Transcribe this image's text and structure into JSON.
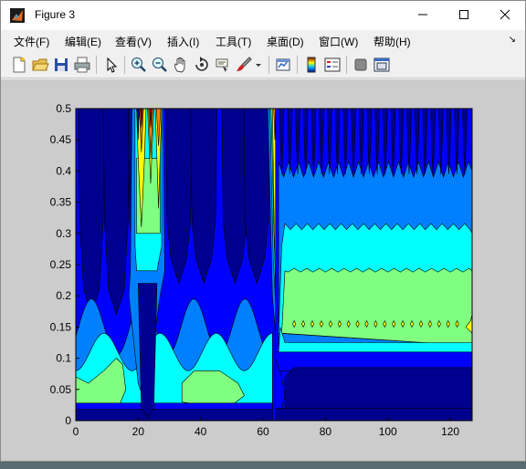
{
  "window": {
    "title": "Figure 3"
  },
  "menu": [
    {
      "label": "文件(F)"
    },
    {
      "label": "编辑(E)"
    },
    {
      "label": "查看(V)"
    },
    {
      "label": "插入(I)"
    },
    {
      "label": "工具(T)"
    },
    {
      "label": "桌面(D)"
    },
    {
      "label": "窗口(W)"
    },
    {
      "label": "帮助(H)"
    }
  ],
  "toolbar": {
    "icons": [
      "new-figure-icon",
      "open-file-icon",
      "save-icon",
      "print-icon",
      "select-arrow-icon",
      "zoom-in-icon",
      "zoom-out-icon",
      "pan-hand-icon",
      "rotate-3d-icon",
      "data-cursor-icon",
      "brush-icon",
      "brush-dropdown-icon",
      "link-plot-icon",
      "colorbar-icon",
      "legend-icon",
      "hide-plot-tools-icon",
      "show-plot-tools-icon"
    ]
  },
  "chart_data": {
    "type": "heatmap",
    "subtype": "filled-contour",
    "title": "",
    "xlabel": "",
    "ylabel": "",
    "xlim": [
      0,
      127
    ],
    "ylim": [
      0,
      0.5
    ],
    "x_ticks": [
      "0",
      "20",
      "40",
      "60",
      "80",
      "100",
      "120"
    ],
    "y_ticks": [
      "0",
      "0.05",
      "0.1",
      "0.15",
      "0.2",
      "0.25",
      "0.3",
      "0.35",
      "0.4",
      "0.45",
      "0.5"
    ],
    "colormap": "jet",
    "colors": {
      "lowest": "#00008f",
      "low": "#0000ff",
      "mid_low": "#0080ff",
      "mid": "#00ffff",
      "mid_high": "#80ff80",
      "high": "#ffff00",
      "very_high": "#ff8000",
      "highest": "#800000"
    },
    "bands": [
      {
        "region": "x 0-65",
        "y": [
          0,
          0.02
        ],
        "level": "lowest"
      },
      {
        "region": "x 65-127",
        "y": [
          0.02,
          0.08
        ],
        "level": "lowest"
      },
      {
        "region": "x 65-127",
        "y": [
          0.08,
          0.12
        ],
        "level": "low"
      },
      {
        "region": "x 65-127",
        "y": [
          0.12,
          0.24
        ],
        "level": "mid_high"
      },
      {
        "region": "x 65-127",
        "y": [
          0.24,
          0.31
        ],
        "level": "mid"
      },
      {
        "region": "x 65-127",
        "y": [
          0.31,
          0.4
        ],
        "level": "mid_low"
      },
      {
        "region": "x 65-127",
        "y": [
          0.4,
          0.5
        ],
        "level": "low"
      }
    ],
    "peaks": [
      {
        "x": 22,
        "y": [
          0.3,
          0.5
        ],
        "level": "highest"
      },
      {
        "x": 64,
        "y": [
          0.2,
          0.5
        ],
        "level": "high"
      },
      {
        "x": 126,
        "y": [
          0.15,
          0.15
        ],
        "level": "high"
      }
    ]
  }
}
